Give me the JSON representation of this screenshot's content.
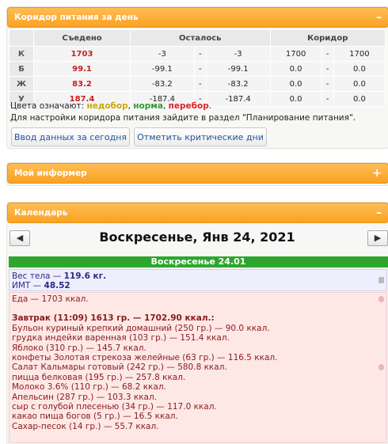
{
  "corridor_panel": {
    "title": "Коридор питания за день",
    "control": "–",
    "columns": {
      "eaten": "Съедено",
      "left": "Осталось",
      "corridor": "Коридор"
    },
    "rows": [
      {
        "label": "К",
        "eaten": "1703",
        "left_min": "-3",
        "left_max": "-3",
        "corr_min": "1700",
        "corr_max": "1700"
      },
      {
        "label": "Б",
        "eaten": "99.1",
        "left_min": "-99.1",
        "left_max": "-99.1",
        "corr_min": "0.0",
        "corr_max": "0.0"
      },
      {
        "label": "Ж",
        "eaten": "83.2",
        "left_min": "-83.2",
        "left_max": "-83.2",
        "corr_min": "0.0",
        "corr_max": "0.0"
      },
      {
        "label": "У",
        "eaten": "187.4",
        "left_min": "-187.4",
        "left_max": "-187.4",
        "corr_min": "0.0",
        "corr_max": "0.0"
      }
    ],
    "dash": "-",
    "legend_prefix": "Цвета означают: ",
    "legend_under": "недобор",
    "legend_norm": "норма",
    "legend_over": "перебор",
    "legend_sep": ", ",
    "legend_end": ".",
    "hint": "Для настройки коридора питания зайдите в раздел \"Планирование питания\".",
    "btn_input": "Ввод данных за сегодня",
    "btn_critical": "Отметить критические дни"
  },
  "informer_panel": {
    "title": "Мой информер",
    "control": "+"
  },
  "calendar_panel": {
    "title": "Календарь",
    "control": "–",
    "prev": "◀",
    "next": "▶",
    "date_title": "Воскресенье, Янв 24, 2021",
    "day_label": "Воскресенье 24.01",
    "weight_label": "Вес тела — ",
    "weight_value": "119.6 кг.",
    "bmi_label": "ИМТ — ",
    "bmi_value": "48.52",
    "food_total": "Еда — 1703 ккал.",
    "breakfast": "Завтрак (11:09) 1613 гр. — 1702.90 ккал.:",
    "items": [
      "Бульон куриный крепкий домашний (250 гр.) — 90.0 ккал.",
      "грудка индейки варенная (103 гр.) — 151.4 ккал.",
      "Яблоко (310 гр.) — 145.7 ккал.",
      "конфеты Золотая стрекоза желейные (63 гр.) — 116.5 ккал.",
      "Салат Кальмары готовый (242 гр.) — 580.8 ккал.",
      "пицца белковая (195 гр.) — 257.8 ккал.",
      "Молоко 3.6% (110 гр.) — 68.2 ккал.",
      "Апельсин (287 гр.) — 103.3 ккал.",
      "сыр с голубой плесенью (34 гр.) — 117.0 ккал.",
      "какао пища богов (5 гр.) — 16.5 ккал.",
      "Сахар-песок (14 гр.) — 55.7 ккал."
    ]
  },
  "colors": {
    "accent": "#f9a223",
    "under": "#c8a800",
    "norm": "#2f9a2f",
    "over": "#d22222",
    "day_bar": "#2ea62e"
  }
}
